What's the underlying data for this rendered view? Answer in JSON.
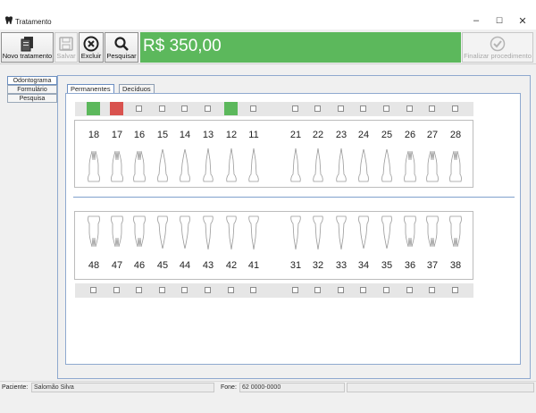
{
  "window": {
    "title": "Tratamento",
    "minimize": "–",
    "maximize": "☐",
    "close": "✕"
  },
  "toolbar": {
    "novo": "Novo tratamento",
    "salvar": "Salvar",
    "excluir": "Excluir",
    "pesquisar": "Pesquisar",
    "finalizar": "Finalizar procedimento",
    "price": "R$ 350,00",
    "price_color": "#5cb85c"
  },
  "side_tabs": [
    "Odontograma",
    "Formulário",
    "Pesquisa"
  ],
  "tabs": [
    "Permanentes",
    "Decíduos"
  ],
  "upper_teeth": [
    "18",
    "17",
    "16",
    "15",
    "14",
    "13",
    "12",
    "11",
    "21",
    "22",
    "23",
    "24",
    "25",
    "26",
    "27",
    "28"
  ],
  "lower_teeth": [
    "48",
    "47",
    "46",
    "45",
    "44",
    "43",
    "42",
    "41",
    "31",
    "32",
    "33",
    "34",
    "35",
    "36",
    "37",
    "38"
  ],
  "upper_status": [
    "green",
    "red",
    "none",
    "none",
    "none",
    "none",
    "green",
    "none",
    "none",
    "none",
    "none",
    "none",
    "none",
    "none",
    "none",
    "none"
  ],
  "status_colors": {
    "green": "#5cb85c",
    "red": "#d9534f"
  },
  "statusbar": {
    "paciente_label": "Paciente:",
    "paciente_value": "Salomão Silva",
    "fone_label": "Fone:",
    "fone_value": "62 0000-0000"
  }
}
